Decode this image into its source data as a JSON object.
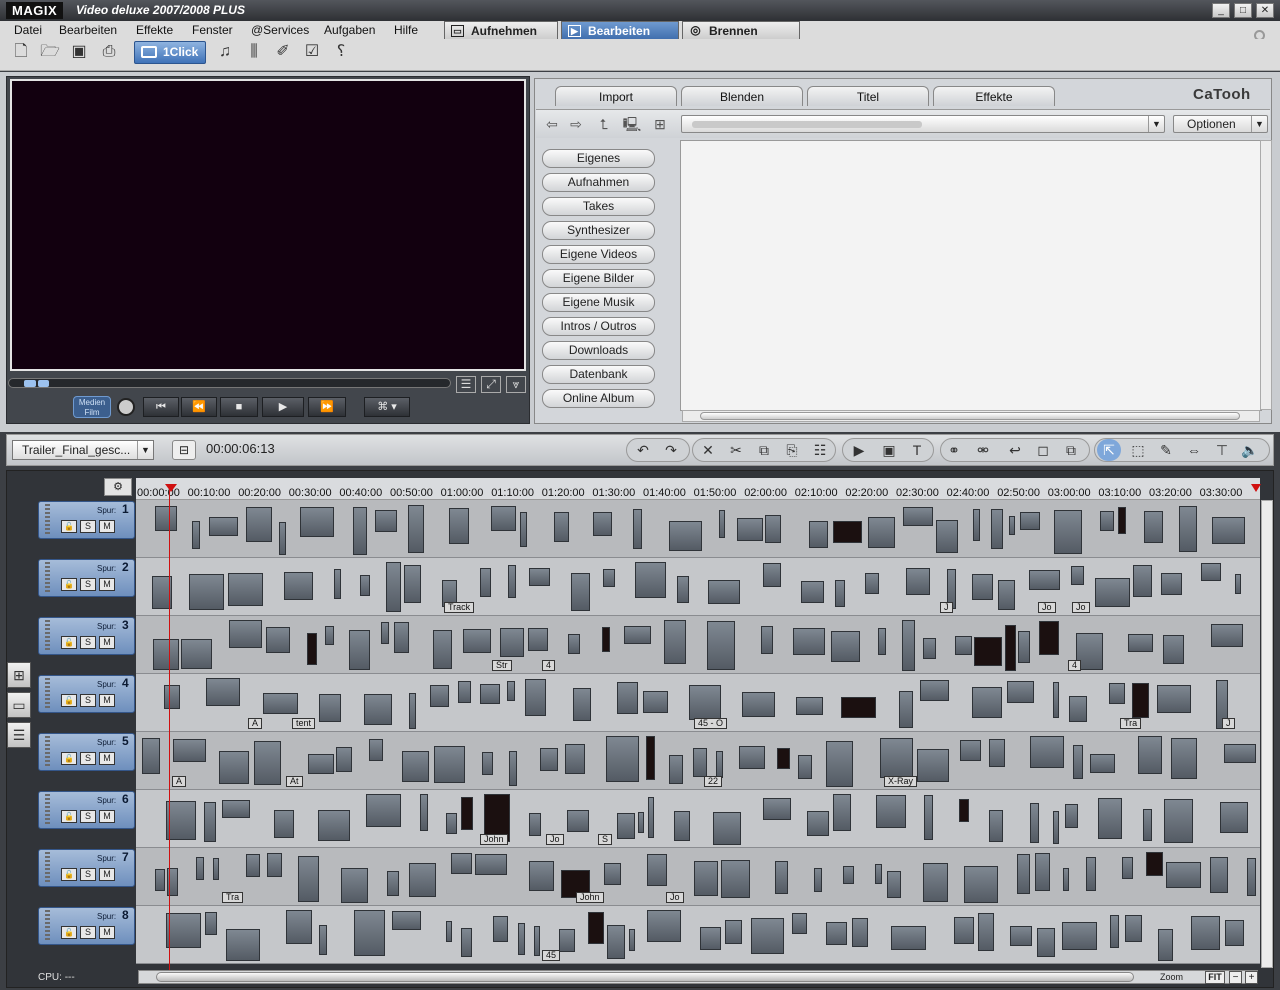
{
  "app": {
    "logo": "MAGIX",
    "title": "Video deluxe 2007/2008 PLUS"
  },
  "window_buttons": [
    "_",
    "□",
    "✕"
  ],
  "menu": [
    "Datei",
    "Bearbeiten",
    "Effekte",
    "Fenster",
    "@Services",
    "Aufgaben",
    "Hilfe"
  ],
  "modes": [
    {
      "label": "Aufnehmen",
      "icon": "▭"
    },
    {
      "label": "Bearbeiten",
      "icon": "▶"
    },
    {
      "label": "Brennen",
      "icon": "◎"
    }
  ],
  "toolbar": {
    "oneclick": "1Click"
  },
  "transport": {
    "medien": "Medien",
    "film": "Film"
  },
  "browser": {
    "tabs": [
      "Import",
      "Blenden",
      "Titel",
      "Effekte"
    ],
    "brand": "CaTooh",
    "options_label": "Optionen",
    "sources": [
      "Eigenes",
      "Aufnahmen",
      "Takes",
      "Synthesizer",
      "Eigene Videos",
      "Eigene Bilder",
      "Eigene Musik",
      "Intros / Outros",
      "Downloads",
      "Datenbank",
      "Online Album"
    ]
  },
  "project": {
    "name": "Trailer_Final_gesc...",
    "timecode": "00:00:06:13"
  },
  "ruler": [
    "00:00:00",
    "00:10:00",
    "00:20:00",
    "00:30:00",
    "00:40:00",
    "00:50:00",
    "01:00:00",
    "01:10:00",
    "01:20:00",
    "01:30:00",
    "01:40:00",
    "01:50:00",
    "02:00:00",
    "02:10:00",
    "02:20:00",
    "02:30:00",
    "02:40:00",
    "02:50:00",
    "03:00:00",
    "03:10:00",
    "03:20:00",
    "03:30:00"
  ],
  "track_label": "Spur:",
  "solo": "S",
  "mute": "M",
  "tracks": [
    "1",
    "2",
    "3",
    "4",
    "5",
    "6",
    "7",
    "8"
  ],
  "clip_labels": [
    {
      "track": 2,
      "text": "Track"
    },
    {
      "track": 2,
      "text": "J"
    },
    {
      "track": 2,
      "text": "Jo"
    },
    {
      "track": 2,
      "text": "Jo"
    },
    {
      "track": 3,
      "text": "Str"
    },
    {
      "track": 3,
      "text": "4"
    },
    {
      "track": 3,
      "text": "4"
    },
    {
      "track": 4,
      "text": "A"
    },
    {
      "track": 4,
      "text": "tent"
    },
    {
      "track": 4,
      "text": "45 - O"
    },
    {
      "track": 4,
      "text": "Tra"
    },
    {
      "track": 4,
      "text": "J"
    },
    {
      "track": 5,
      "text": "A"
    },
    {
      "track": 5,
      "text": "At"
    },
    {
      "track": 5,
      "text": "22"
    },
    {
      "track": 5,
      "text": "X-Ray"
    },
    {
      "track": 6,
      "text": "John"
    },
    {
      "track": 6,
      "text": "Jo"
    },
    {
      "track": 6,
      "text": "S"
    },
    {
      "track": 7,
      "text": "Tra"
    },
    {
      "track": 7,
      "text": "John"
    },
    {
      "track": 7,
      "text": "Jo"
    },
    {
      "track": 8,
      "text": "45"
    }
  ],
  "status": {
    "cpu_label": "CPU:",
    "cpu_value": "---",
    "zoom": "Zoom",
    "fit": "FIT"
  }
}
